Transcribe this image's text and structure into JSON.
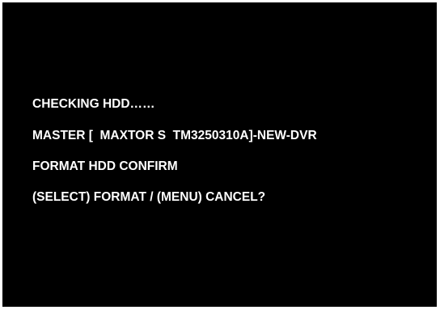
{
  "colors": {
    "background": "#000000",
    "text": "#ffffff",
    "frame": "#ffffff"
  },
  "osd": {
    "line1": "CHECKING HDD……",
    "line2": "MASTER [  MAXTOR S  TM3250310A]-NEW-DVR",
    "line3": "FORMAT HDD CONFIRM",
    "line4": "(SELECT) FORMAT / (MENU) CANCEL?"
  }
}
